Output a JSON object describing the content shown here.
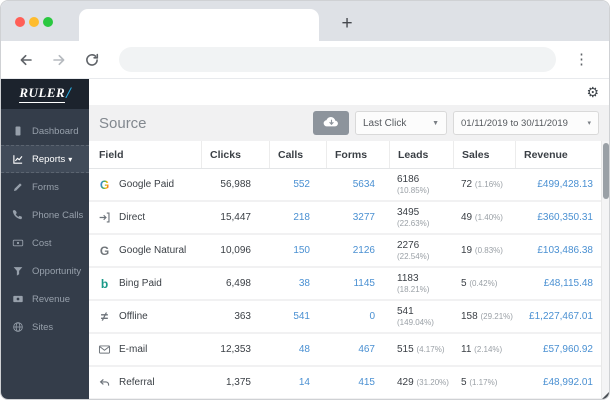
{
  "window": {
    "new_tab_button": "+",
    "traffic_lights": {
      "close": "#ff5f57",
      "minimize": "#febc2e",
      "maximize": "#2ac840"
    }
  },
  "colors": {
    "accent_blue": "#4a90d2",
    "sidebar_bg": "#343d4a",
    "logo_band_bg": "#1c232d",
    "active_item_bg": "#414b59",
    "header_band_bg": "#f1f1f2",
    "export_button_bg": "#8d949c"
  },
  "app": {
    "logo_text": "RULER",
    "logo_slash": "/",
    "sidebar": {
      "items": [
        {
          "label": "Dashboard",
          "icon": "dashboard-icon",
          "active": false
        },
        {
          "label": "Reports",
          "icon": "line-chart-icon",
          "active": true,
          "caret": "▾"
        },
        {
          "label": "Forms",
          "icon": "pencil-icon",
          "active": false
        },
        {
          "label": "Phone Calls",
          "icon": "phone-icon",
          "active": false
        },
        {
          "label": "Cost",
          "icon": "banknote-icon",
          "active": false
        },
        {
          "label": "Opportunity",
          "icon": "funnel-icon",
          "active": false
        },
        {
          "label": "Revenue",
          "icon": "money-icon",
          "active": false
        },
        {
          "label": "Sites",
          "icon": "globe-icon",
          "active": false
        }
      ]
    },
    "settings_icon": "gear-icon",
    "report_header": {
      "title": "Source",
      "export_icon": "cloud-download-icon",
      "attribution_model": "Last Click",
      "date_range": "01/11/2019 to 30/11/2019"
    },
    "table": {
      "columns": [
        "Field",
        "Clicks",
        "Calls",
        "Forms",
        "Leads",
        "Sales",
        "Revenue"
      ],
      "rows": [
        {
          "field": "Google Paid",
          "icon": "google-color-icon",
          "clicks": "56,988",
          "calls": "552",
          "forms": "5634",
          "leads": "6186",
          "leads_pct": "(10.85%)",
          "sales": "72",
          "sales_pct": "(1.16%)",
          "revenue": "£499,428.13"
        },
        {
          "field": "Direct",
          "icon": "sign-in-icon",
          "clicks": "15,447",
          "calls": "218",
          "forms": "3277",
          "leads": "3495",
          "leads_pct": "(22.63%)",
          "sales": "49",
          "sales_pct": "(1.40%)",
          "revenue": "£360,350.31"
        },
        {
          "field": "Google Natural",
          "icon": "google-gray-icon",
          "clicks": "10,096",
          "calls": "150",
          "forms": "2126",
          "leads": "2276",
          "leads_pct": "(22.54%)",
          "sales": "19",
          "sales_pct": "(0.83%)",
          "revenue": "£103,486.38"
        },
        {
          "field": "Bing Paid",
          "icon": "bing-icon",
          "clicks": "6,498",
          "calls": "38",
          "forms": "1145",
          "leads": "1183",
          "leads_pct": "(18.21%)",
          "sales": "5",
          "sales_pct": "(0.42%)",
          "revenue": "£48,115.48"
        },
        {
          "field": "Offline",
          "icon": "not-equal-icon",
          "clicks": "363",
          "calls": "541",
          "forms": "0",
          "leads": "541",
          "leads_pct": "(149.04%)",
          "sales": "158",
          "sales_pct": "(29.21%)",
          "revenue": "£1,227,467.01"
        },
        {
          "field": "E-mail",
          "icon": "envelope-icon",
          "clicks": "12,353",
          "calls": "48",
          "forms": "467",
          "leads": "515",
          "leads_pct": "(4.17%)",
          "sales": "11",
          "sales_pct": "(2.14%)",
          "revenue": "£57,960.92"
        },
        {
          "field": "Referral",
          "icon": "reply-arrow-icon",
          "clicks": "1,375",
          "calls": "14",
          "forms": "415",
          "leads": "429",
          "leads_pct": "(31.20%)",
          "sales": "5",
          "sales_pct": "(1.17%)",
          "revenue": "£48,992.01"
        }
      ]
    }
  }
}
